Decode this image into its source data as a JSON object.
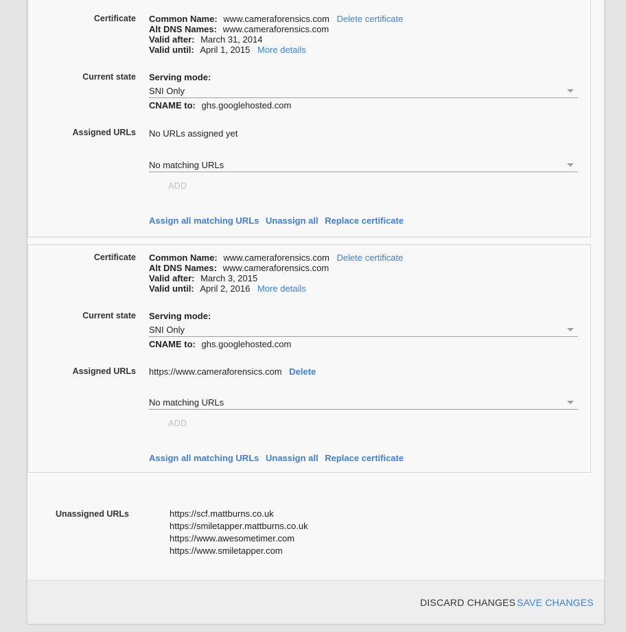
{
  "certificates": [
    {
      "certificate_label": "Certificate",
      "common_name_key": "Common Name:",
      "common_name": "www.cameraforensics.com",
      "delete_certificate": "Delete certificate",
      "alt_dns_key": "Alt DNS Names:",
      "alt_dns": "www.cameraforensics.com",
      "valid_after_key": "Valid after:",
      "valid_after": "March 31, 2014",
      "valid_until_key": "Valid until:",
      "valid_until": "April 1, 2015",
      "more_details": "More details",
      "current_state_label": "Current state",
      "serving_mode_key": "Serving mode:",
      "serving_mode": "SNI Only",
      "cname_key": "CNAME to:",
      "cname": "ghs.googlehosted.com",
      "assigned_urls_label": "Assigned URLs",
      "assigned_text": "No URLs assigned yet",
      "assigned_delete": "",
      "matching_select": "No matching URLs",
      "add_label": "ADD",
      "assign_all": "Assign all matching URLs",
      "unassign_all": "Unassign all",
      "replace_certificate": "Replace certificate"
    },
    {
      "certificate_label": "Certificate",
      "common_name_key": "Common Name:",
      "common_name": "www.cameraforensics.com",
      "delete_certificate": "Delete certificate",
      "alt_dns_key": "Alt DNS Names:",
      "alt_dns": "www.cameraforensics.com",
      "valid_after_key": "Valid after:",
      "valid_after": "March 3, 2015",
      "valid_until_key": "Valid until:",
      "valid_until": "April 2, 2016",
      "more_details": "More details",
      "current_state_label": "Current state",
      "serving_mode_key": "Serving mode:",
      "serving_mode": "SNI Only",
      "cname_key": "CNAME to:",
      "cname": "ghs.googlehosted.com",
      "assigned_urls_label": "Assigned URLs",
      "assigned_text": "https://www.cameraforensics.com",
      "assigned_delete": "Delete",
      "matching_select": "No matching URLs",
      "add_label": "ADD",
      "assign_all": "Assign all matching URLs",
      "unassign_all": "Unassign all",
      "replace_certificate": "Replace certificate"
    }
  ],
  "unassigned": {
    "label": "Unassigned URLs",
    "urls": [
      "https://scf.mattburns.co.uk",
      "https://smiletapper.mattburns.co.uk",
      "https://www.awesometimer.com",
      "https://www.smiletapper.com"
    ]
  },
  "footer": {
    "discard": "DISCARD CHANGES",
    "save": "SAVE CHANGES"
  },
  "colors": {
    "link": "#3d7fd9",
    "disabled": "#c2c2c2",
    "page_bg": "#e5e5e5",
    "panel_bg": "#f8f8f8"
  },
  "icons": {
    "select_caret": "chevron-down-icon"
  }
}
